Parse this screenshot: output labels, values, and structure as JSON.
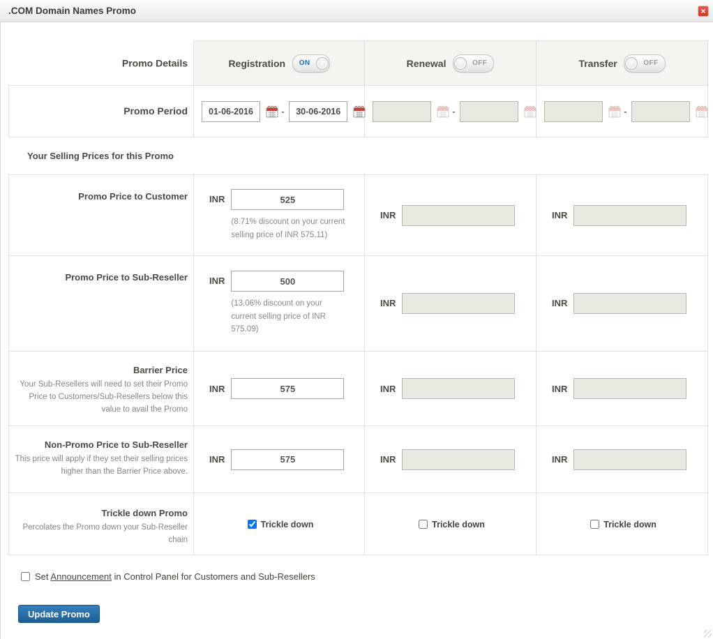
{
  "window": {
    "title": ".COM Domain Names Promo",
    "close_icon": "×"
  },
  "table": {
    "details_header": "Promo Details",
    "period_label": "Promo Period",
    "section_header": "Your Selling Prices for this Promo",
    "currency_label": "INR",
    "row_labels": {
      "customer": "Promo Price to Customer",
      "sub_reseller": "Promo Price to Sub-Reseller",
      "barrier": "Barrier Price",
      "barrier_desc": "Your Sub-Resellers will need to set their Promo Price to Customers/Sub-Resellers below this value to avail the Promo",
      "non_promo": "Non-Promo Price to Sub-Reseller",
      "non_promo_desc": "This price will apply if they set their selling prices higher than the Barrier Price above.",
      "trickle": "Trickle down Promo",
      "trickle_desc": "Percolates the Promo down your Sub-Reseller chain",
      "trickle_checkbox": "Trickle down"
    },
    "columns": [
      {
        "label": "Registration",
        "toggle_state": "ON",
        "period_from": "01-06-2016",
        "period_to": "30-06-2016",
        "price_customer": "525",
        "customer_note": "(8.71% discount on your current selling price of INR 575.11)",
        "price_sub_reseller": "500",
        "sub_reseller_note": "(13.06% discount on your current selling price of INR 575.09)",
        "price_barrier": "575",
        "price_non_promo": "575",
        "trickle_checked": true
      },
      {
        "label": "Renewal",
        "toggle_state": "OFF",
        "period_from": "",
        "period_to": "",
        "price_customer": "",
        "price_sub_reseller": "",
        "price_barrier": "",
        "price_non_promo": "",
        "trickle_checked": false
      },
      {
        "label": "Transfer",
        "toggle_state": "OFF",
        "period_from": "",
        "period_to": "",
        "price_customer": "",
        "price_sub_reseller": "",
        "price_barrier": "",
        "price_non_promo": "",
        "trickle_checked": false
      }
    ]
  },
  "footer": {
    "announcement_checked": false,
    "announcement_prefix": "Set ",
    "announcement_link": "Announcement",
    "announcement_suffix": " in Control Panel for Customers and Sub-Resellers",
    "update_button": "Update Promo"
  },
  "colors": {
    "toggle_on_text": "#1f6fb5",
    "button_blue": "#2e78b0",
    "close_red": "#d4453a",
    "calendar_red": "#cc3b33",
    "disabled_field_bg": "#e9e8e1"
  }
}
